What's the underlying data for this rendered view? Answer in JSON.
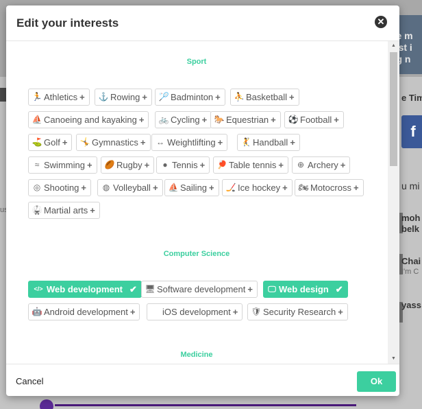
{
  "background": {
    "header_lines": [
      "ole m",
      "vast i",
      "ing n"
    ],
    "right_labels": [
      "e Tim",
      "u mi",
      "moh",
      "belk",
      "Chai",
      "I'm C",
      "yass"
    ],
    "left_label": "us",
    "fb_letter": "f"
  },
  "modal": {
    "title": "Edit your interests",
    "close_glyph": "✕",
    "cancel_label": "Cancel",
    "ok_label": "Ok",
    "accent_color": "#3ccf9f"
  },
  "sections": [
    {
      "title": "Sport",
      "tags": [
        {
          "label": "Athletics",
          "icon": "athletics-icon",
          "glyph": "🏃",
          "selected": false
        },
        {
          "label": "Rowing",
          "icon": "rowing-icon",
          "glyph": "⚓",
          "selected": false
        },
        {
          "label": "Badminton",
          "icon": "badminton-icon",
          "glyph": "🏸",
          "selected": false
        },
        {
          "label": "Basketball",
          "icon": "basketball-icon",
          "glyph": "⛹",
          "selected": false
        },
        {
          "label": "Canoeing and kayaking",
          "icon": "canoeing-icon",
          "glyph": "⛵",
          "selected": false
        },
        {
          "label": "Cycling",
          "icon": "cycling-icon",
          "glyph": "🚲",
          "selected": false
        },
        {
          "label": "Equestrian",
          "icon": "equestrian-icon",
          "glyph": "🐎",
          "selected": false
        },
        {
          "label": "Football",
          "icon": "football-icon",
          "glyph": "⚽",
          "selected": false
        },
        {
          "label": "Golf",
          "icon": "golf-icon",
          "glyph": "⛳",
          "selected": false
        },
        {
          "label": "Gymnastics",
          "icon": "gymnastics-icon",
          "glyph": "🤸",
          "selected": false
        },
        {
          "label": "Weightlifting",
          "icon": "weightlifting-icon",
          "glyph": "↔",
          "selected": false
        },
        {
          "label": "Handball",
          "icon": "handball-icon",
          "glyph": "🤾",
          "selected": false
        },
        {
          "label": "Swimming",
          "icon": "swimming-icon",
          "glyph": "≈",
          "selected": false
        },
        {
          "label": "Rugby",
          "icon": "rugby-icon",
          "glyph": "🏉",
          "selected": false
        },
        {
          "label": "Tennis",
          "icon": "tennis-icon",
          "glyph": "●",
          "selected": false
        },
        {
          "label": "Table tennis",
          "icon": "table-tennis-icon",
          "glyph": "🏓",
          "selected": false
        },
        {
          "label": "Archery",
          "icon": "archery-icon",
          "glyph": "⊕",
          "selected": false
        },
        {
          "label": "Shooting",
          "icon": "shooting-icon",
          "glyph": "◎",
          "selected": false
        },
        {
          "label": "Volleyball",
          "icon": "volleyball-icon",
          "glyph": "◍",
          "selected": false
        },
        {
          "label": "Sailing",
          "icon": "sailing-icon",
          "glyph": "⛵",
          "selected": false
        },
        {
          "label": "Ice hockey",
          "icon": "ice-hockey-icon",
          "glyph": "🏒",
          "selected": false
        },
        {
          "label": "Motocross",
          "icon": "motocross-icon",
          "glyph": "🏍",
          "selected": false
        },
        {
          "label": "Martial arts",
          "icon": "martial-arts-icon",
          "glyph": "🥋",
          "selected": false
        }
      ]
    },
    {
      "title": "Computer Science",
      "tags": [
        {
          "label": "Web development",
          "icon": "code-icon",
          "glyph": "</>",
          "selected": true
        },
        {
          "label": "Software development",
          "icon": "monitor-icon",
          "glyph": "🖥",
          "selected": false
        },
        {
          "label": "Web design",
          "icon": "web-design-icon",
          "glyph": "🖵",
          "selected": true
        },
        {
          "label": "Android development",
          "icon": "android-icon",
          "glyph": "🤖",
          "selected": false
        },
        {
          "label": "iOS development",
          "icon": "apple-icon",
          "glyph": "",
          "selected": false
        },
        {
          "label": "Security Research",
          "icon": "shield-icon",
          "glyph": "🛡",
          "selected": false
        }
      ]
    },
    {
      "title": "Medicine",
      "tags": []
    }
  ]
}
